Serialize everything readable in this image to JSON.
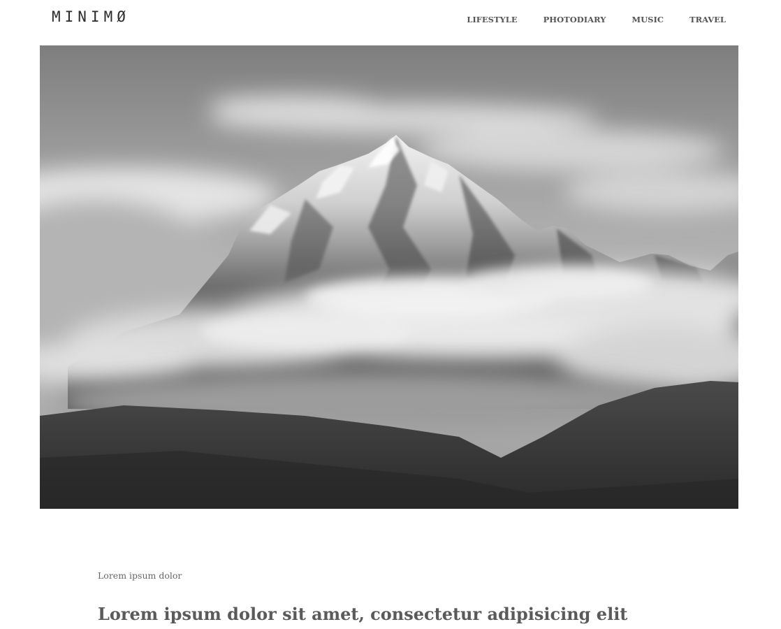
{
  "header": {
    "logo_text": "MINIMØ",
    "nav": [
      {
        "label": "LIFESTYLE"
      },
      {
        "label": "PHOTODIARY"
      },
      {
        "label": "MUSIC"
      },
      {
        "label": "TRAVEL"
      }
    ]
  },
  "hero": {
    "icon": "mountain-landscape-photo"
  },
  "post": {
    "category": "Lorem ipsum dolor",
    "title": "Lorem ipsum dolor sit amet, consectetur adipisicing elit"
  },
  "colors": {
    "background": "#ffffff",
    "text": "#5a5a5a",
    "logo": "#2b2b2b"
  }
}
